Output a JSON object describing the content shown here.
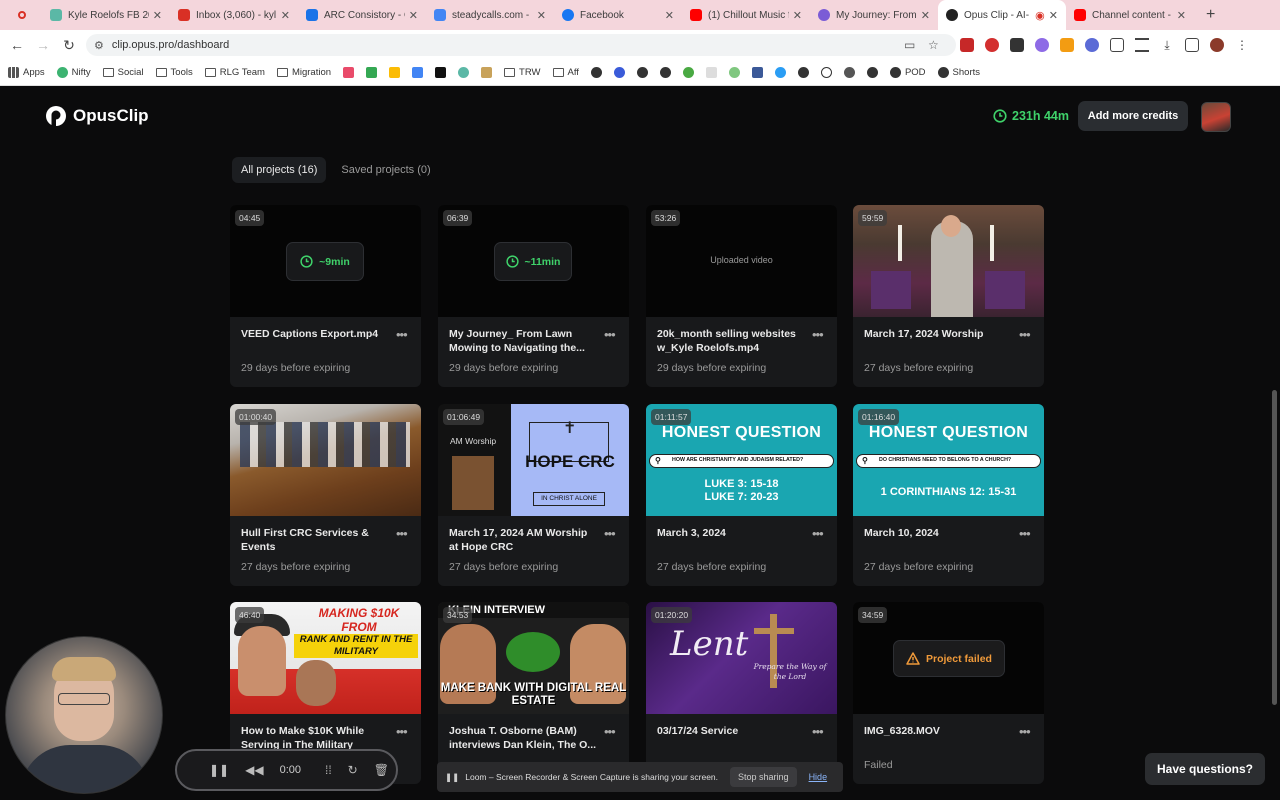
{
  "browser": {
    "tabs": [
      {
        "title": "Kyle Roelofs FB 20",
        "color": "#5bb8a6"
      },
      {
        "title": "Inbox (3,060) - kyl",
        "color": "#d93025"
      },
      {
        "title": "ARC Consistory - C",
        "color": "#1a73e8"
      },
      {
        "title": "steadycalls.com -",
        "color": "#4285f4"
      },
      {
        "title": "Facebook",
        "color": "#1877f2"
      },
      {
        "title": "(1) Chillout Music f",
        "color": "#ff0000"
      },
      {
        "title": "My Journey: From L",
        "color": "#7b5cd6"
      },
      {
        "title": "Opus Clip - AI-",
        "color": "#222222"
      },
      {
        "title": "Channel content -",
        "color": "#ff0000"
      }
    ],
    "url": "clip.opus.pro/dashboard",
    "bookmarks": [
      "Apps",
      "Nifty",
      "Social",
      "Tools",
      "RLG Team",
      "Migration",
      "TRW",
      "Aff",
      "POD",
      "Shorts"
    ]
  },
  "header": {
    "logo_text": "OpusClip",
    "credits": "231h 44m",
    "add_credits_label": "Add more credits"
  },
  "project_tabs": {
    "all": "All projects (16)",
    "saved": "Saved projects (0)"
  },
  "projects": [
    {
      "duration": "04:45",
      "title": "VEED Captions Export.mp4",
      "status": "29 days before expiring",
      "pill": "~9min"
    },
    {
      "duration": "06:39",
      "title": "My Journey_ From Lawn Mowing to Navigating the...",
      "status": "29 days before expiring",
      "pill": "~11min"
    },
    {
      "duration": "53:26",
      "title": "20k_month selling websites w_Kyle Roelofs.mp4",
      "status": "29 days before expiring",
      "note": "Uploaded video"
    },
    {
      "duration": "59:59",
      "title": "March 17, 2024 Worship",
      "status": "27 days before expiring"
    },
    {
      "duration": "01:00:40",
      "title": "Hull First CRC Services & Events",
      "status": "27 days before expiring"
    },
    {
      "duration": "01:06:49",
      "title": "March 17, 2024 AM Worship at Hope CRC",
      "status": "27 days before expiring",
      "thumb_text": {
        "left": "AM Worship",
        "main": "HOPE CRC",
        "sub": "IN CHRIST ALONE"
      }
    },
    {
      "duration": "01:11:57",
      "title": "March 3, 2024",
      "status": "27 days before expiring",
      "thumb_text": {
        "heading": "HONEST QUESTION",
        "question": "HOW ARE CHRISTIANITY AND JUDAISM RELATED?",
        "ref1": "LUKE 3: 15-18",
        "ref2": "LUKE 7: 20-23"
      }
    },
    {
      "duration": "01:16:40",
      "title": "March 10, 2024",
      "status": "27 days before expiring",
      "thumb_text": {
        "heading": "HONEST QUESTION",
        "question": "DO CHRISTIANS NEED TO BELONG TO A CHURCH?",
        "ref1": "1 CORINTHIANS 12: 15-31"
      }
    },
    {
      "duration": "46:40",
      "title": "How to Make $10K While Serving in The Military",
      "status": "",
      "thumb_text": {
        "line1": "MAKING $10K FROM",
        "line2": "RANK AND RENT IN THE MILITARY"
      }
    },
    {
      "duration": "34:53",
      "title": "Joshua T. Osborne (BAM) interviews Dan Klein, The O...",
      "status": "",
      "thumb_text": {
        "header": "KLEIN INTERVIEW",
        "bottom": "MAKE BANK WITH DIGITAL REAL ESTATE"
      }
    },
    {
      "duration": "01:20:20",
      "title": "03/17/24 Service",
      "status": "",
      "thumb_text": {
        "main": "Lent",
        "sub": "Prepare the Way of the Lord"
      }
    },
    {
      "duration": "34:59",
      "title": "IMG_6328.MOV",
      "status": "Failed",
      "failed_label": "Project failed"
    }
  ],
  "loom": {
    "time": "0:00",
    "share_text": "Loom – Screen Recorder & Screen Capture is sharing your screen.",
    "stop_label": "Stop sharing",
    "hide_label": "Hide"
  },
  "help_label": "Have questions?",
  "colors": {
    "accent_green": "#3fd26a",
    "warning_orange": "#f09a3a",
    "background": "#0b0b0c",
    "card": "#18191b"
  }
}
